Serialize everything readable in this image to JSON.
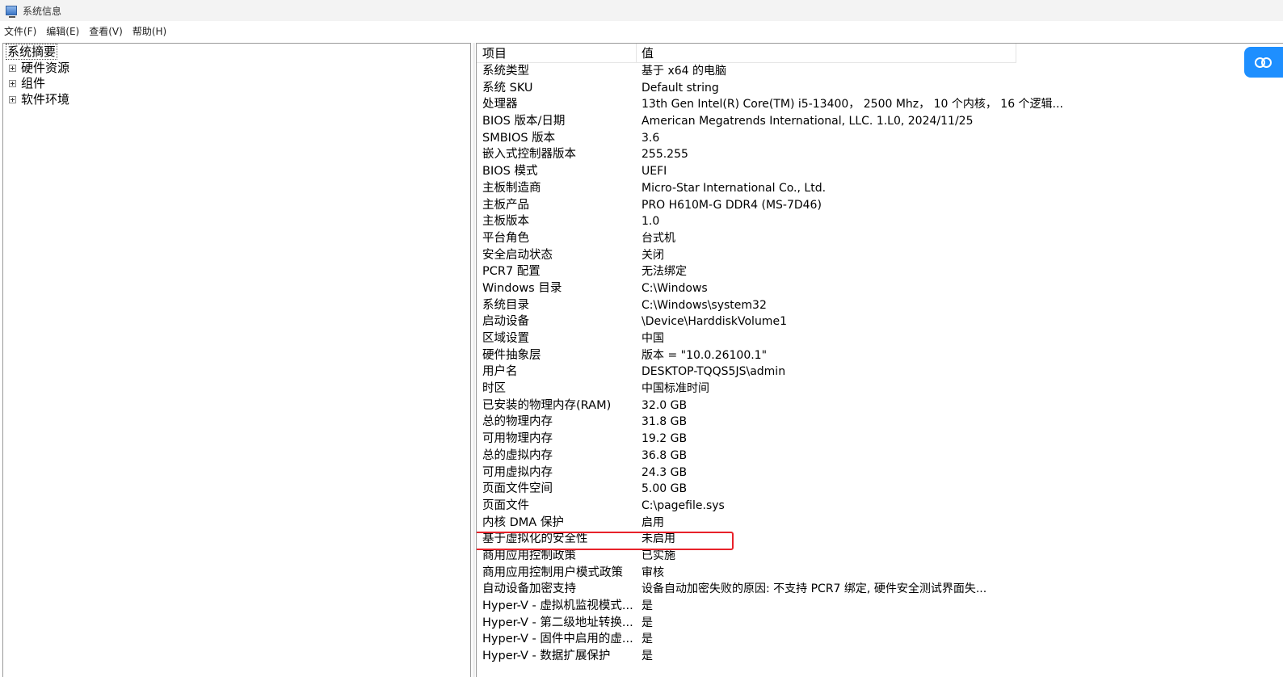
{
  "window": {
    "title": "系统信息"
  },
  "menu": [
    {
      "label": "文件(F)"
    },
    {
      "label": "编辑(E)"
    },
    {
      "label": "查看(V)"
    },
    {
      "label": "帮助(H)"
    }
  ],
  "tree": {
    "root": "系统摘要",
    "nodes": [
      {
        "label": "硬件资源"
      },
      {
        "label": "组件"
      },
      {
        "label": "软件环境"
      }
    ]
  },
  "list": {
    "header": {
      "item": "项目",
      "value": "值"
    },
    "rows": [
      {
        "item": "系统类型",
        "value": "基于 x64 的电脑"
      },
      {
        "item": "系统 SKU",
        "value": "Default string"
      },
      {
        "item": "处理器",
        "value": "13th Gen Intel(R) Core(TM) i5-13400， 2500 Mhz， 10 个内核， 16 个逻辑..."
      },
      {
        "item": "BIOS 版本/日期",
        "value": "American Megatrends International, LLC. 1.L0, 2024/11/25"
      },
      {
        "item": "SMBIOS 版本",
        "value": "3.6"
      },
      {
        "item": "嵌入式控制器版本",
        "value": "255.255"
      },
      {
        "item": "BIOS 模式",
        "value": "UEFI"
      },
      {
        "item": "主板制造商",
        "value": "Micro-Star International Co., Ltd."
      },
      {
        "item": "主板产品",
        "value": "PRO H610M-G DDR4 (MS-7D46)"
      },
      {
        "item": "主板版本",
        "value": "1.0"
      },
      {
        "item": "平台角色",
        "value": "台式机"
      },
      {
        "item": "安全启动状态",
        "value": "关闭"
      },
      {
        "item": "PCR7 配置",
        "value": "无法绑定"
      },
      {
        "item": "Windows 目录",
        "value": "C:\\Windows"
      },
      {
        "item": "系统目录",
        "value": "C:\\Windows\\system32"
      },
      {
        "item": "启动设备",
        "value": "\\Device\\HarddiskVolume1"
      },
      {
        "item": "区域设置",
        "value": "中国"
      },
      {
        "item": "硬件抽象层",
        "value": "版本 = \"10.0.26100.1\""
      },
      {
        "item": "用户名",
        "value": "DESKTOP-TQQS5JS\\admin"
      },
      {
        "item": "时区",
        "value": "中国标准时间"
      },
      {
        "item": "已安装的物理内存(RAM)",
        "value": "32.0 GB"
      },
      {
        "item": "总的物理内存",
        "value": "31.8 GB"
      },
      {
        "item": "可用物理内存",
        "value": "19.2 GB"
      },
      {
        "item": "总的虚拟内存",
        "value": "36.8 GB"
      },
      {
        "item": "可用虚拟内存",
        "value": "24.3 GB"
      },
      {
        "item": "页面文件空间",
        "value": "5.00 GB"
      },
      {
        "item": "页面文件",
        "value": "C:\\pagefile.sys"
      },
      {
        "item": "内核 DMA 保护",
        "value": "启用"
      },
      {
        "item": "基于虚拟化的安全性",
        "value": "未启用"
      },
      {
        "item": "商用应用控制政策",
        "value": "已实施"
      },
      {
        "item": "商用应用控制用户模式政策",
        "value": "审核"
      },
      {
        "item": "自动设备加密支持",
        "value": "设备自动加密失败的原因: 不支持 PCR7 绑定, 硬件安全测试界面失..."
      },
      {
        "item": "Hyper-V - 虚拟机监视模式...",
        "value": "是"
      },
      {
        "item": "Hyper-V - 第二级地址转换...",
        "value": "是"
      },
      {
        "item": "Hyper-V - 固件中启用的虚...",
        "value": "是"
      },
      {
        "item": "Hyper-V - 数据扩展保护",
        "value": "是"
      }
    ]
  },
  "colors": {
    "highlight_border": "#e8222a",
    "cloud_button": "#1e8fff"
  },
  "icons": {
    "app": "system-info-icon",
    "expander": "plus-expander-icon",
    "floating": "cloud-icon"
  }
}
